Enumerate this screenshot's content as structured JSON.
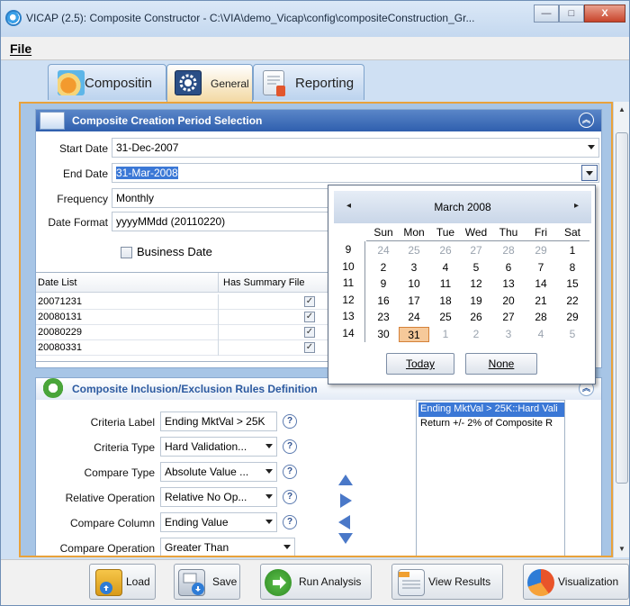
{
  "window": {
    "title": "VICAP (2.5): Composite Constructor - C:\\VIA\\demo_Vicap\\config\\compositeConstruction_Gr...",
    "minimize": "—",
    "maximize": "□",
    "close": "X"
  },
  "menu": {
    "file": "File"
  },
  "tabs": [
    {
      "label": "Compositin",
      "icon": "composite-icon"
    },
    {
      "label": "General",
      "icon": "gear-icon",
      "active": true
    },
    {
      "label": "Reporting",
      "icon": "report-icon"
    }
  ],
  "period": {
    "title": "Composite Creation Period Selection",
    "start_label": "Start Date",
    "start_value": "31-Dec-2007",
    "end_label": "End Date",
    "end_value": "31-Mar-2008",
    "frequency_label": "Frequency",
    "frequency_value": "Monthly",
    "format_label": "Date Format",
    "format_value": "yyyyMMdd (20110220)",
    "business_date_label": "Business Date",
    "grid": {
      "headers": [
        "Date List",
        "Has Summary File"
      ],
      "rows": [
        {
          "date": "20071231",
          "has_summary": true
        },
        {
          "date": "20080131",
          "has_summary": true
        },
        {
          "date": "20080229",
          "has_summary": true
        },
        {
          "date": "20080331",
          "has_summary": true
        }
      ]
    }
  },
  "calendar": {
    "month": "March 2008",
    "prev": "◂",
    "next": "▸",
    "days_of_week": [
      "Sun",
      "Mon",
      "Tue",
      "Wed",
      "Thu",
      "Fri",
      "Sat"
    ],
    "weeks": [
      {
        "week": "9",
        "days": [
          "24",
          "25",
          "26",
          "27",
          "28",
          "29",
          "1"
        ],
        "other": [
          true,
          true,
          true,
          true,
          true,
          true,
          false
        ]
      },
      {
        "week": "10",
        "days": [
          "2",
          "3",
          "4",
          "5",
          "6",
          "7",
          "8"
        ],
        "other": [
          false,
          false,
          false,
          false,
          false,
          false,
          false
        ]
      },
      {
        "week": "11",
        "days": [
          "9",
          "10",
          "11",
          "12",
          "13",
          "14",
          "15"
        ],
        "other": [
          false,
          false,
          false,
          false,
          false,
          false,
          false
        ]
      },
      {
        "week": "12",
        "days": [
          "16",
          "17",
          "18",
          "19",
          "20",
          "21",
          "22"
        ],
        "other": [
          false,
          false,
          false,
          false,
          false,
          false,
          false
        ]
      },
      {
        "week": "13",
        "days": [
          "23",
          "24",
          "25",
          "26",
          "27",
          "28",
          "29"
        ],
        "other": [
          false,
          false,
          false,
          false,
          false,
          false,
          false
        ]
      },
      {
        "week": "14",
        "days": [
          "30",
          "31",
          "1",
          "2",
          "3",
          "4",
          "5"
        ],
        "other": [
          false,
          false,
          true,
          true,
          true,
          true,
          true
        ]
      }
    ],
    "selected_day": "31",
    "today_label": "Today",
    "none_label": "None"
  },
  "rules": {
    "title": "Composite Inclusion/Exclusion Rules Definition",
    "criteria_label_label": "Criteria Label",
    "criteria_label_value": "Ending MktVal > 25K",
    "criteria_type_label": "Criteria Type",
    "criteria_type_value": "Hard Validation...",
    "compare_type_label": "Compare Type",
    "compare_type_value": "Absolute Value ...",
    "relative_op_label": "Relative Operation",
    "relative_op_value": "Relative No Op...",
    "compare_column_label": "Compare Column",
    "compare_column_value": "Ending Value",
    "compare_op_label": "Compare Operation",
    "compare_op_value": "Greater Than",
    "help": "?",
    "list": [
      {
        "text": "Ending MktVal > 25K::Hard Vali",
        "selected": true
      },
      {
        "text": "Return +/- 2% of Composite R",
        "selected": false
      }
    ]
  },
  "buttons": {
    "load": "Load",
    "save": "Save",
    "run": "Run Analysis",
    "view": "View Results",
    "viz": "Visualization"
  },
  "colors": {
    "accent_orange": "#e9a23b",
    "header_blue": "#2f5fae",
    "selection_blue": "#3b78d6"
  }
}
